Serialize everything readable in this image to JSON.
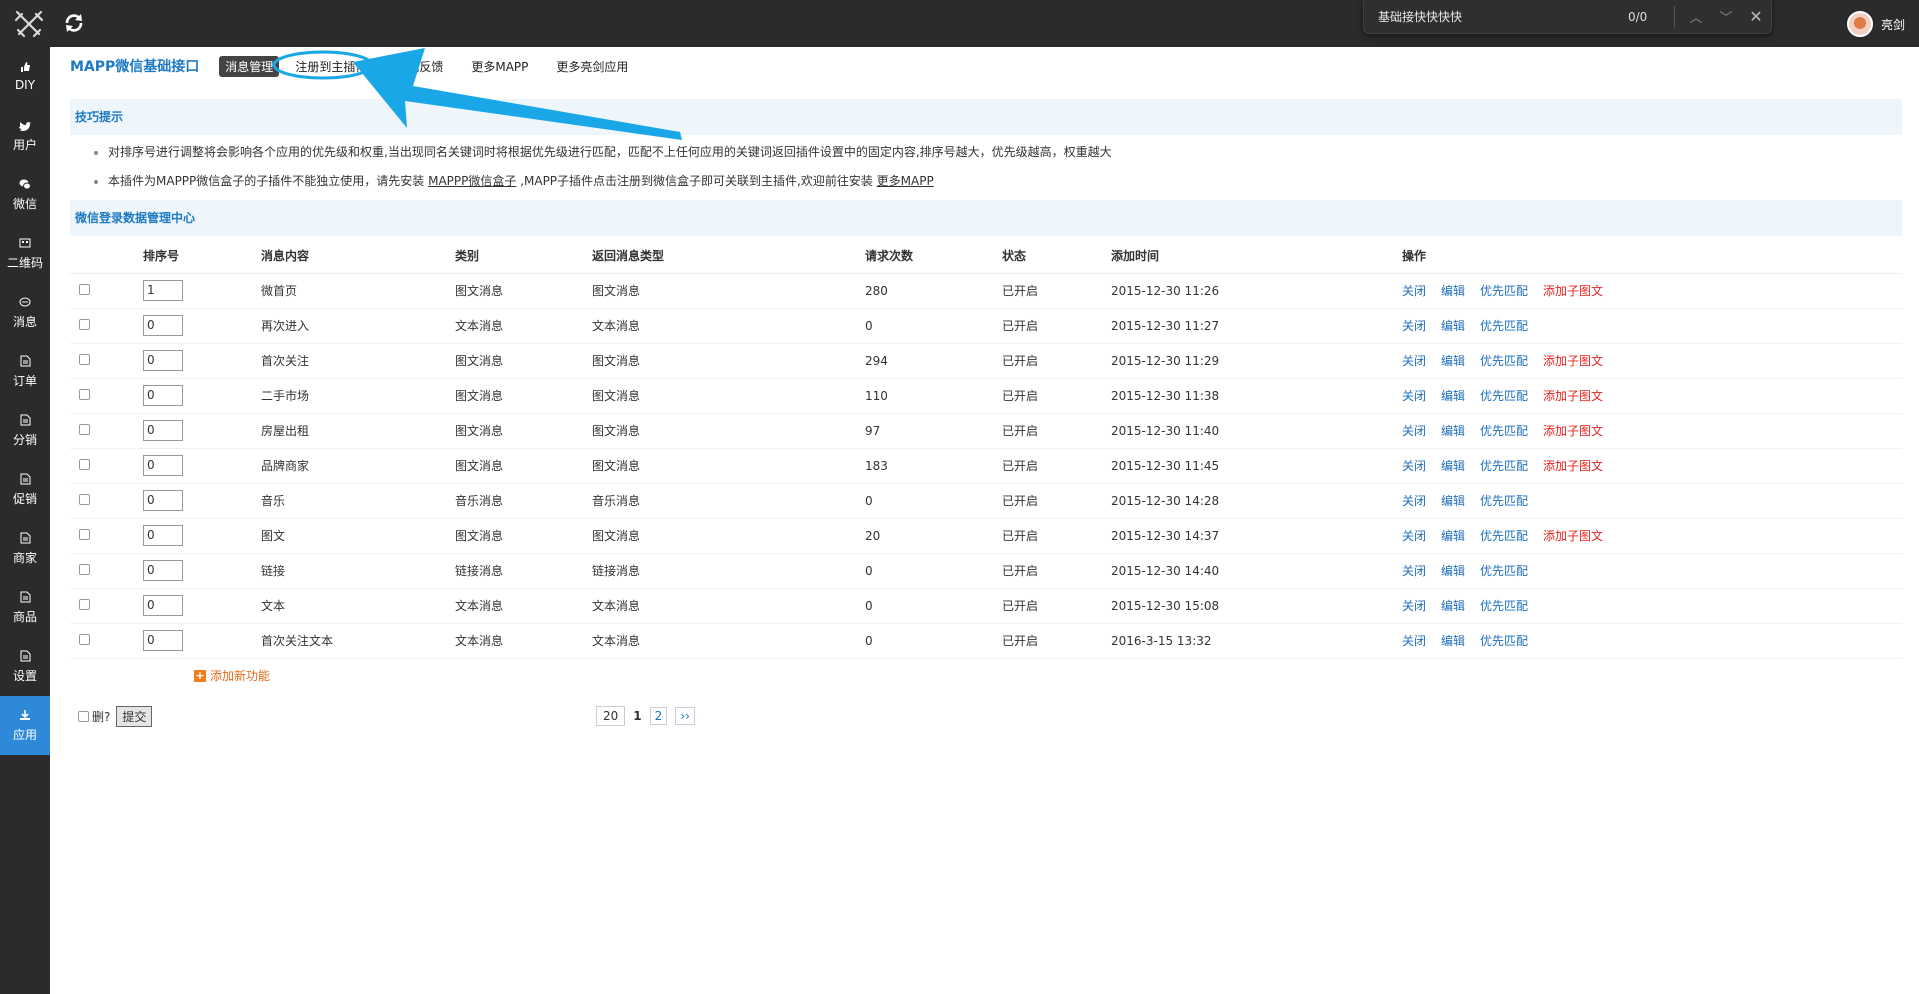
{
  "findbar": {
    "query": "基础接快快快快",
    "count": "0/0",
    "prev_icon": "chevron-up-icon",
    "next_icon": "chevron-down-icon",
    "close_icon": "close-icon"
  },
  "user": {
    "name": "亮剑"
  },
  "sidebar": {
    "items": [
      {
        "label": "DIY",
        "icon": "thumb-icon"
      },
      {
        "label": "用户",
        "icon": "twitter-icon"
      },
      {
        "label": "微信",
        "icon": "wechat-icon"
      },
      {
        "label": "二维码",
        "icon": "qrcode-icon"
      },
      {
        "label": "消息",
        "icon": "chat-icon"
      },
      {
        "label": "订单",
        "icon": "document-icon"
      },
      {
        "label": "分销",
        "icon": "document-icon"
      },
      {
        "label": "促销",
        "icon": "document-icon"
      },
      {
        "label": "商家",
        "icon": "document-icon"
      },
      {
        "label": "商品",
        "icon": "document-icon"
      },
      {
        "label": "设置",
        "icon": "document-icon"
      },
      {
        "label": "应用",
        "icon": "download-icon"
      }
    ]
  },
  "subnav": {
    "title": "MAPP微信基础接口",
    "items": [
      "消息管理",
      "注册到主插件",
      "意见反馈",
      "更多MAPP",
      "更多亮剑应用"
    ]
  },
  "tips": {
    "title": "技巧提示",
    "line1": "对排序号进行调整将会影响各个应用的优先级和权重,当出现同名关键词时将根据优先级进行匹配，匹配不上任何应用的关键词返回插件设置中的固定内容,排序号越大，优先级越高，权重越大",
    "line2_prefix": "本插件为MAPPP微信盒子的子插件不能独立使用，请先安装 ",
    "line2_link1": "MAPPP微信盒子",
    "line2_mid": " ,MAPP子插件点击注册到微信盒子即可关联到主插件,欢迎前往安装 ",
    "line2_link2": "更多MAPP"
  },
  "center": {
    "title": "微信登录数据管理中心"
  },
  "table": {
    "headers": [
      "排序号",
      "消息内容",
      "类别",
      "返回消息类型",
      "请求次数",
      "状态",
      "添加时间",
      "操作"
    ],
    "actions": {
      "close": "关闭",
      "edit": "编辑",
      "priority": "优先匹配",
      "add_sub": "添加子图文"
    },
    "rows": [
      {
        "order": "1",
        "content": "微首页",
        "category": "图文消息",
        "return_type": "图文消息",
        "requests": "280",
        "status": "已开启",
        "time": "2015-12-30 11:26",
        "has_sub": true
      },
      {
        "order": "0",
        "content": "再次进入",
        "category": "文本消息",
        "return_type": "文本消息",
        "requests": "0",
        "status": "已开启",
        "time": "2015-12-30 11:27",
        "has_sub": false
      },
      {
        "order": "0",
        "content": "首次关注",
        "category": "图文消息",
        "return_type": "图文消息",
        "requests": "294",
        "status": "已开启",
        "time": "2015-12-30 11:29",
        "has_sub": true
      },
      {
        "order": "0",
        "content": "二手市场",
        "category": "图文消息",
        "return_type": "图文消息",
        "requests": "110",
        "status": "已开启",
        "time": "2015-12-30 11:38",
        "has_sub": true
      },
      {
        "order": "0",
        "content": "房屋出租",
        "category": "图文消息",
        "return_type": "图文消息",
        "requests": "97",
        "status": "已开启",
        "time": "2015-12-30 11:40",
        "has_sub": true
      },
      {
        "order": "0",
        "content": "品牌商家",
        "category": "图文消息",
        "return_type": "图文消息",
        "requests": "183",
        "status": "已开启",
        "time": "2015-12-30 11:45",
        "has_sub": true
      },
      {
        "order": "0",
        "content": "音乐",
        "category": "音乐消息",
        "return_type": "音乐消息",
        "requests": "0",
        "status": "已开启",
        "time": "2015-12-30 14:28",
        "has_sub": false
      },
      {
        "order": "0",
        "content": "图文",
        "category": "图文消息",
        "return_type": "图文消息",
        "requests": "20",
        "status": "已开启",
        "time": "2015-12-30 14:37",
        "has_sub": true
      },
      {
        "order": "0",
        "content": "链接",
        "category": "链接消息",
        "return_type": "链接消息",
        "requests": "0",
        "status": "已开启",
        "time": "2015-12-30 14:40",
        "has_sub": false
      },
      {
        "order": "0",
        "content": "文本",
        "category": "文本消息",
        "return_type": "文本消息",
        "requests": "0",
        "status": "已开启",
        "time": "2015-12-30 15:08",
        "has_sub": false
      },
      {
        "order": "0",
        "content": "首次关注文本",
        "category": "文本消息",
        "return_type": "文本消息",
        "requests": "0",
        "status": "已开启",
        "time": "2016-3-15 13:32",
        "has_sub": false
      }
    ],
    "add_new": "添加新功能"
  },
  "footer": {
    "delete_label": "删?",
    "submit": "提交"
  },
  "pager": {
    "page_size": "20",
    "current": "1",
    "next_page": "2",
    "next_icon": "››"
  },
  "colors": {
    "accent": "#1e7ac4",
    "danger": "#e8231f",
    "annotation": "#1aa7e8",
    "active_nav": "#2e8ad8"
  }
}
